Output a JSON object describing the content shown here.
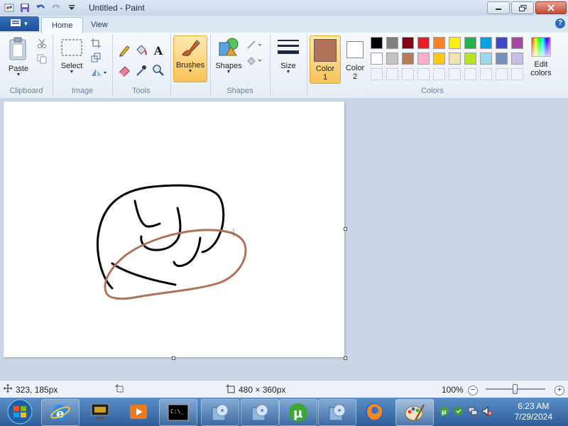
{
  "window": {
    "title": "Untitled - Paint"
  },
  "tabs": {
    "home": "Home",
    "view": "View"
  },
  "clipboard": {
    "paste": "Paste",
    "group": "Clipboard"
  },
  "image": {
    "select": "Select",
    "group": "Image"
  },
  "tools": {
    "group": "Tools"
  },
  "brushes": {
    "label": "Brushes"
  },
  "shapes": {
    "label": "Shapes",
    "group": "Shapes"
  },
  "size": {
    "label": "Size"
  },
  "colors": {
    "color1_label_a": "Color",
    "color1_label_b": "1",
    "color1_value": "#b0735a",
    "color2_label_a": "Color",
    "color2_label_b": "2",
    "color2_value": "#ffffff",
    "edit_label_a": "Edit",
    "edit_label_b": "colors",
    "group": "Colors",
    "palette_row1": [
      "#000000",
      "#7f7f7f",
      "#880015",
      "#ed1c24",
      "#ff7f27",
      "#fff200",
      "#22b14c",
      "#00a2e8",
      "#3f48cc",
      "#a349a4"
    ],
    "palette_row2": [
      "#ffffff",
      "#c3c3c3",
      "#b97a57",
      "#ffaec9",
      "#ffc90e",
      "#efe4b0",
      "#b5e61d",
      "#99d9ea",
      "#7092be",
      "#c8bfe7"
    ]
  },
  "status": {
    "cursor_pos": "323, 185px",
    "canvas_size": "480 × 360px",
    "zoom": "100%"
  },
  "taskbar": {
    "time": "6:23 AM",
    "date": "7/29/2024"
  },
  "icons": [
    "file-menu-icon",
    "save-icon",
    "undo-icon",
    "redo-icon",
    "paste-icon",
    "cut-icon",
    "copy-icon",
    "select-icon",
    "crop-icon",
    "resize-icon",
    "rotate-icon",
    "pencil-icon",
    "fill-icon",
    "text-icon",
    "eraser-icon",
    "color-picker-icon",
    "magnifier-icon",
    "brushes-icon",
    "shapes-icon",
    "outline-icon",
    "fill-shape-icon",
    "size-icon",
    "edit-colors-icon"
  ]
}
